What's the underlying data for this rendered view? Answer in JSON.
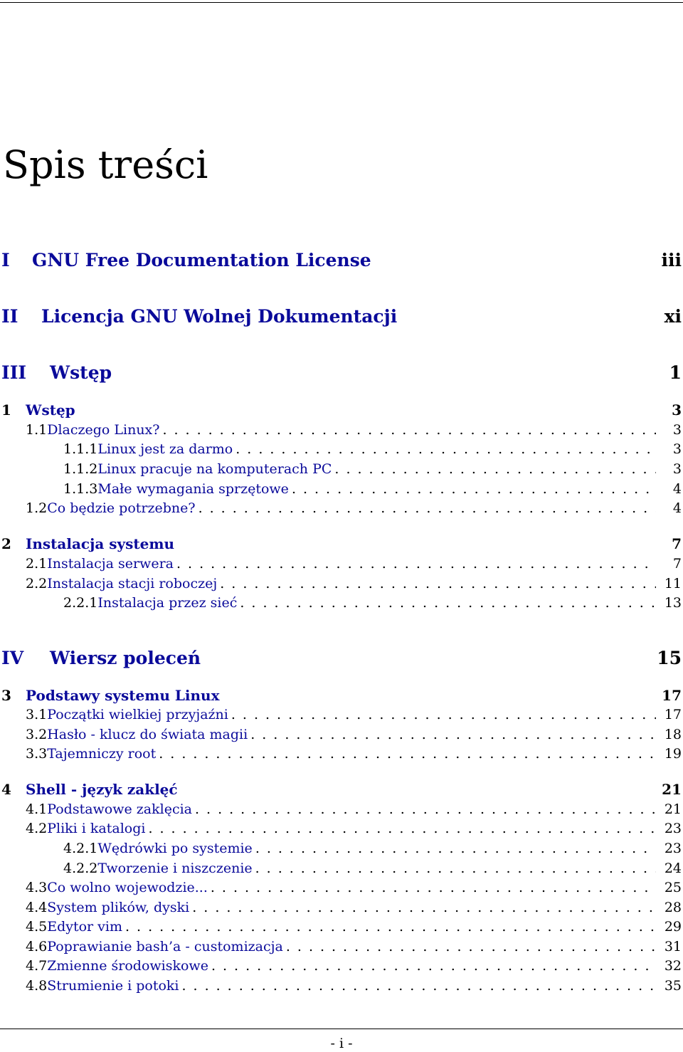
{
  "title": "Spis treści",
  "footer": "- i -",
  "entries": [
    {
      "level": "part",
      "num": "I",
      "label": "GNU Free Documentation License",
      "page": "iii"
    },
    {
      "level": "part",
      "num": "II",
      "label": "Licencja GNU Wolnej Dokumentacji",
      "page": "xi"
    },
    {
      "level": "part",
      "num": "III",
      "label": "Wstęp",
      "page": "1"
    },
    {
      "level": "chapter",
      "num": "1",
      "label": "Wstęp",
      "page": "3"
    },
    {
      "level": "section",
      "num": "1.1",
      "label": "Dlaczego Linux?",
      "page": "3"
    },
    {
      "level": "subsection",
      "num": "1.1.1",
      "label": "Linux jest za darmo",
      "page": "3"
    },
    {
      "level": "subsection",
      "num": "1.1.2",
      "label": "Linux pracuje na komputerach PC",
      "page": "3"
    },
    {
      "level": "subsection",
      "num": "1.1.3",
      "label": "Małe wymagania sprzętowe",
      "page": "4"
    },
    {
      "level": "section",
      "num": "1.2",
      "label": "Co będzie potrzebne?",
      "page": "4"
    },
    {
      "level": "chapter",
      "num": "2",
      "label": "Instalacja systemu",
      "page": "7"
    },
    {
      "level": "section",
      "num": "2.1",
      "label": "Instalacja serwera",
      "page": "7"
    },
    {
      "level": "section",
      "num": "2.2",
      "label": "Instalacja stacji roboczej",
      "page": "11"
    },
    {
      "level": "subsection",
      "num": "2.2.1",
      "label": "Instalacja przez sieć",
      "page": "13"
    },
    {
      "level": "part",
      "num": "IV",
      "label": "Wiersz poleceń",
      "page": "15"
    },
    {
      "level": "chapter",
      "num": "3",
      "label": "Podstawy systemu Linux",
      "page": "17"
    },
    {
      "level": "section",
      "num": "3.1",
      "label": "Początki wielkiej przyjaźni",
      "page": "17"
    },
    {
      "level": "section",
      "num": "3.2",
      "label": "Hasło - klucz do świata magii",
      "page": "18"
    },
    {
      "level": "section",
      "num": "3.3",
      "label": "Tajemniczy root",
      "page": "19"
    },
    {
      "level": "chapter",
      "num": "4",
      "label": "Shell - język zaklęć",
      "page": "21"
    },
    {
      "level": "section",
      "num": "4.1",
      "label": "Podstawowe zaklęcia",
      "page": "21"
    },
    {
      "level": "section",
      "num": "4.2",
      "label": "Pliki i katalogi",
      "page": "23"
    },
    {
      "level": "subsection",
      "num": "4.2.1",
      "label": "Wędrówki po systemie",
      "page": "23"
    },
    {
      "level": "subsection",
      "num": "4.2.2",
      "label": "Tworzenie i niszczenie",
      "page": "24"
    },
    {
      "level": "section",
      "num": "4.3",
      "label": "Co wolno wojewodzie...",
      "page": "25"
    },
    {
      "level": "section",
      "num": "4.4",
      "label": "System plików, dyski",
      "page": "28"
    },
    {
      "level": "section",
      "num": "4.5",
      "label": "Edytor vim",
      "page": "29"
    },
    {
      "level": "section",
      "num": "4.6",
      "label": "Poprawianie bash’a - customizacja",
      "page": "31"
    },
    {
      "level": "section",
      "num": "4.7",
      "label": "Zmienne środowiskowe",
      "page": "32"
    },
    {
      "level": "section",
      "num": "4.8",
      "label": "Strumienie i potoki",
      "page": "35"
    }
  ]
}
